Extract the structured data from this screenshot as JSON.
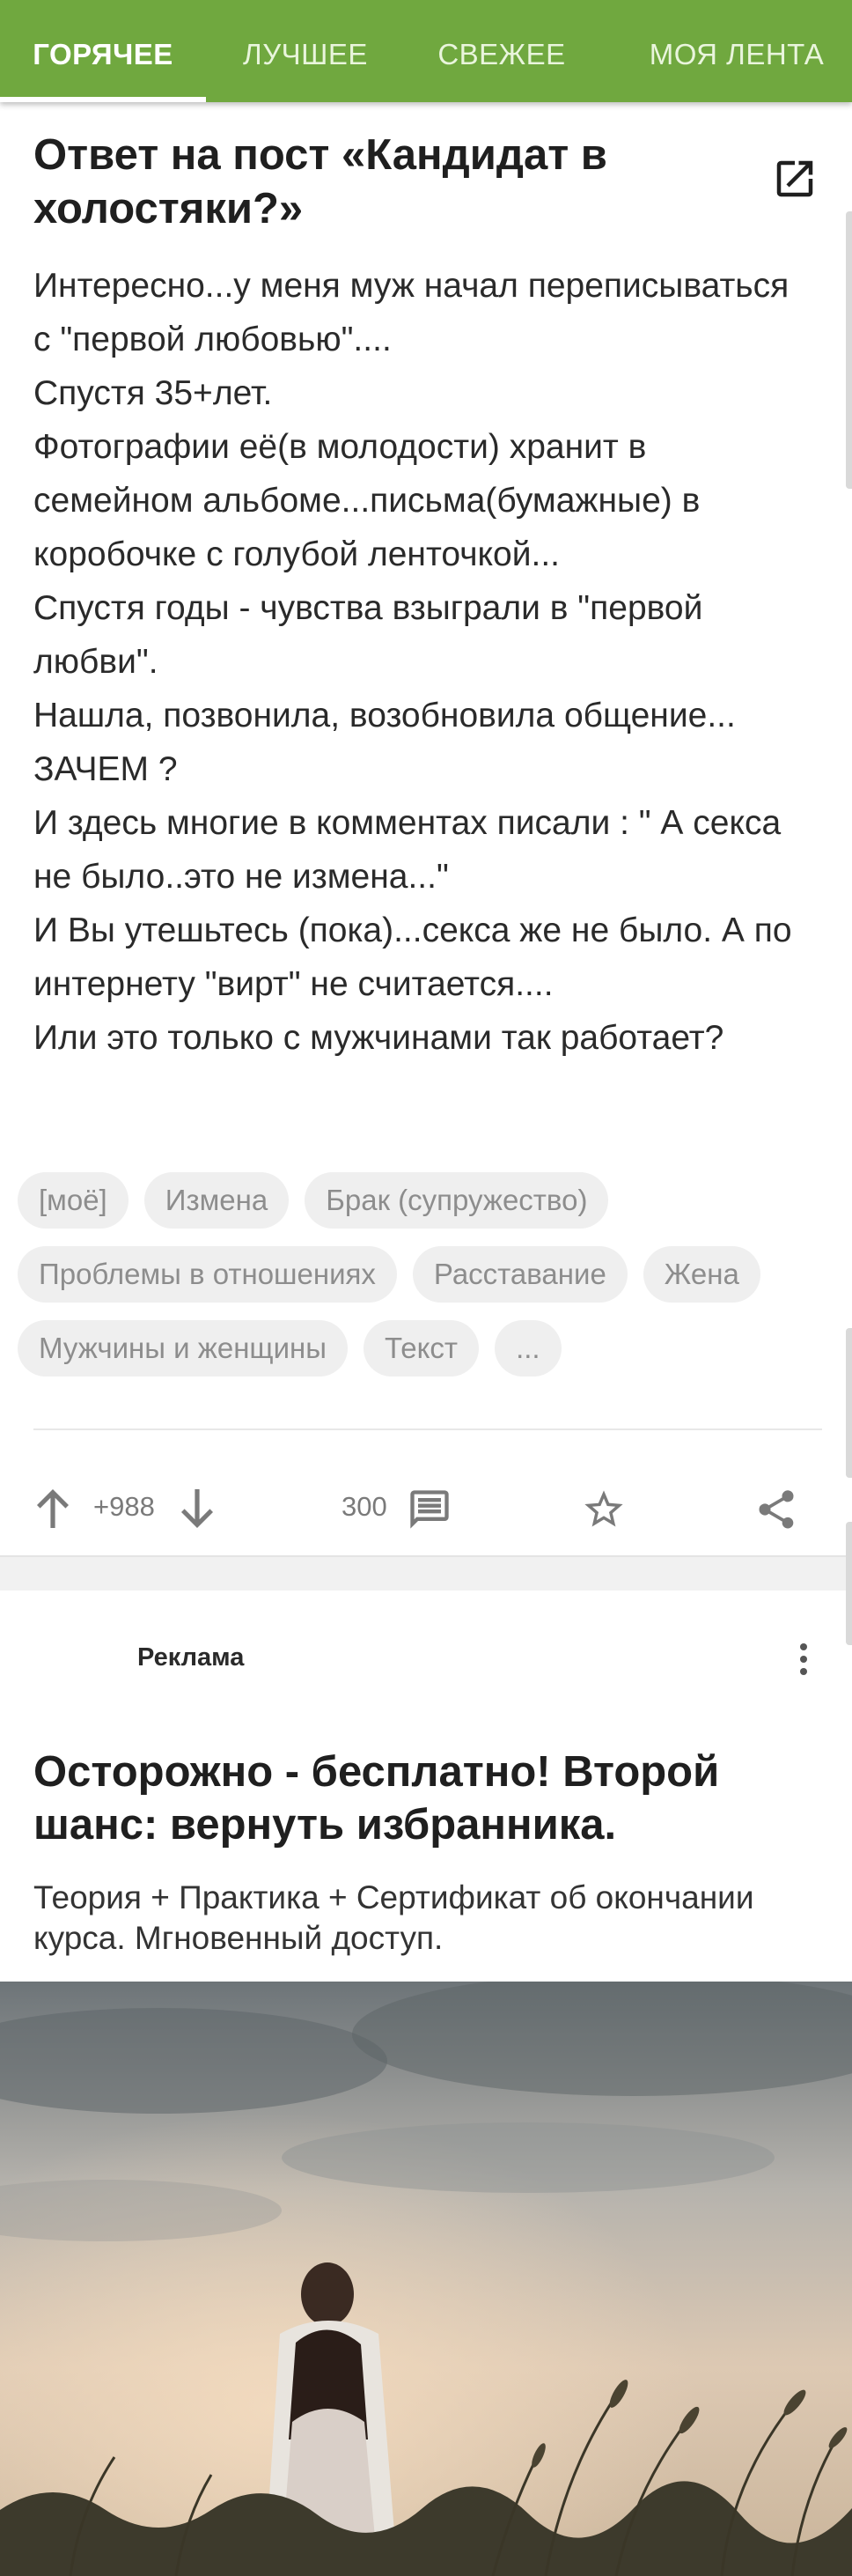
{
  "tabs": [
    {
      "label": "ГОРЯЧЕЕ",
      "active": true
    },
    {
      "label": "ЛУЧШЕЕ",
      "active": false
    },
    {
      "label": "СВЕЖЕЕ",
      "active": false
    },
    {
      "label": "МОЯ ЛЕНТА",
      "active": false
    }
  ],
  "post": {
    "title": "Ответ на пост «Кандидат в холостяки?»",
    "open_icon": "open-in-new-icon",
    "body": "Интересно...у меня муж начал переписываться с \"первой любовью\"....\nСпустя 35+лет.\nФотографии её(в молодости) хранит в семейном альбоме...письма(бумажные) в коробочке с голубой ленточкой...\nСпустя годы - чувства взыграли в \"первой любви\".\nНашла, позвонила, возобновила общение...\nЗАЧЕМ ?\nИ здесь многие в комментах писали : \" А секса не было..это не измена...\"\nИ Вы утешьтесь (пока)...секса же не было. А по интернету \"вирт\" не считается....\nИли это только с мужчинами  так работает?",
    "tags": [
      "[моё]",
      "Измена",
      "Брак (супружество)",
      "Проблемы в отношениях",
      "Расставание",
      "Жена",
      "Мужчины и женщины",
      "Текст",
      "..."
    ],
    "rating": "+988",
    "comments": "300"
  },
  "ad": {
    "label": "Реклама",
    "title": "Осторожно - бесплатно! Второй шанс: вернуть избранника.",
    "description": "Теория + Практика + Сертификат об окончании курса. Мгновенный доступ."
  },
  "colors": {
    "accent": "#70a83f",
    "tag_bg": "#efefef",
    "icon": "#7a7a7a"
  }
}
